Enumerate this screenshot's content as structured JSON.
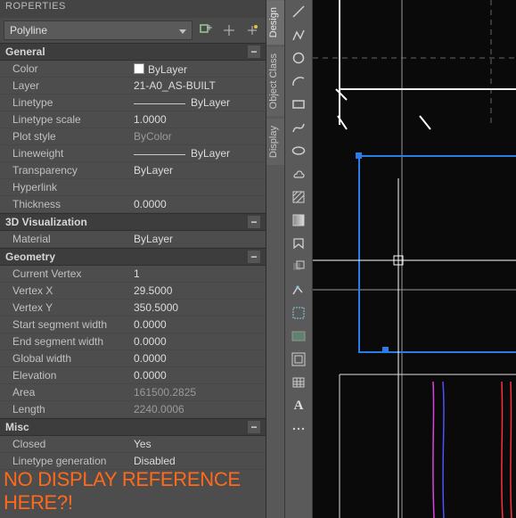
{
  "panel": {
    "title": "ROPERTIES",
    "selector": {
      "value": "Polyline"
    },
    "icons": {
      "quickselect": "quick-select-icon",
      "pickadd": "pick-add-icon",
      "selectobjects": "select-objects-icon"
    }
  },
  "sections": {
    "general": {
      "title": "General",
      "rows": {
        "color": {
          "label": "Color",
          "value": "ByLayer"
        },
        "layer": {
          "label": "Layer",
          "value": "21-A0_AS-BUILT"
        },
        "linetype": {
          "label": "Linetype",
          "value": "ByLayer"
        },
        "ltscale": {
          "label": "Linetype scale",
          "value": "1.0000"
        },
        "plotstyle": {
          "label": "Plot style",
          "value": "ByColor"
        },
        "lineweight": {
          "label": "Lineweight",
          "value": "ByLayer"
        },
        "transparency": {
          "label": "Transparency",
          "value": "ByLayer"
        },
        "hyperlink": {
          "label": "Hyperlink",
          "value": ""
        },
        "thickness": {
          "label": "Thickness",
          "value": "0.0000"
        }
      }
    },
    "viz": {
      "title": "3D Visualization",
      "rows": {
        "material": {
          "label": "Material",
          "value": "ByLayer"
        }
      }
    },
    "geometry": {
      "title": "Geometry",
      "rows": {
        "cv": {
          "label": "Current Vertex",
          "value": "1"
        },
        "vx": {
          "label": "Vertex X",
          "value": "29.5000"
        },
        "vy": {
          "label": "Vertex Y",
          "value": "350.5000"
        },
        "ssw": {
          "label": "Start segment width",
          "value": "0.0000"
        },
        "esw": {
          "label": "End segment width",
          "value": "0.0000"
        },
        "gw": {
          "label": "Global width",
          "value": "0.0000"
        },
        "elev": {
          "label": "Elevation",
          "value": "0.0000"
        },
        "area": {
          "label": "Area",
          "value": "161500.2825"
        },
        "length": {
          "label": "Length",
          "value": "2240.0006"
        }
      }
    },
    "misc": {
      "title": "Misc",
      "rows": {
        "closed": {
          "label": "Closed",
          "value": "Yes"
        },
        "ltgen": {
          "label": "Linetype generation",
          "value": "Disabled"
        }
      }
    }
  },
  "tabs": {
    "design": "Design",
    "objectclass": "Object Class",
    "display": "Display"
  },
  "annotation": "NO DISPLAY REFERENCE HERE?!"
}
